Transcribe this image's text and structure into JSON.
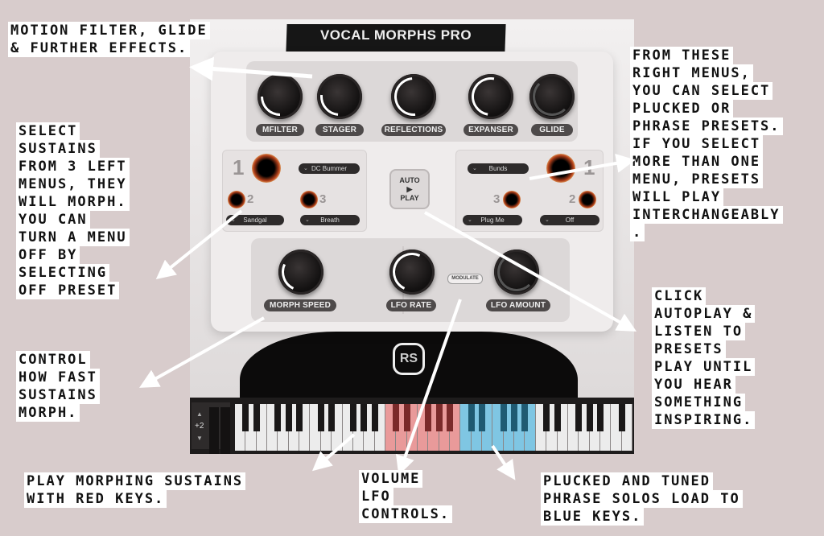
{
  "plugin": {
    "title": "VOCAL MORPHS PRO",
    "logo": "RS",
    "fx_knobs": [
      {
        "label": "MFILTER",
        "value": 0.15
      },
      {
        "label": "STAGER",
        "value": 0.2
      },
      {
        "label": "REFLECTIONS",
        "value": 0.45
      },
      {
        "label": "EXPANSER",
        "value": 0.55
      },
      {
        "label": "GLIDE",
        "value": 0.0
      }
    ],
    "left_menus": {
      "slot1": {
        "number": "1",
        "preset": "DC Bummer"
      },
      "slot2": {
        "number": "2",
        "preset": "Sandgal"
      },
      "slot3": {
        "number": "3",
        "preset": "Breath"
      }
    },
    "right_menus": {
      "slot1": {
        "number": "1",
        "preset": "Bunds"
      },
      "slot2": {
        "number": "2",
        "preset": "Off"
      },
      "slot3": {
        "number": "3",
        "preset": "Plug Me"
      }
    },
    "autoplay": {
      "line1": "AUTO",
      "icon": "▶",
      "line2": "PLAY"
    },
    "lower_knobs": [
      {
        "label": "MORPH SPEED",
        "value": 0.3
      },
      {
        "label": "LFO RATE",
        "value": 0.5
      },
      {
        "label": "LFO AMOUNT",
        "value": 0.0
      }
    ],
    "modulate_label": "MODULATE",
    "keyboard": {
      "octave": "+2",
      "red_range_color": "#e99a9a",
      "blue_range_color": "#7fc6e3"
    }
  },
  "annotations": {
    "top_left": [
      "MOTION FILTER, GLIDE",
      "& FURTHER EFFECTS."
    ],
    "left": [
      "SELECT",
      "SUSTAINS",
      "FROM 3 LEFT",
      "MENUS, THEY",
      "WILL MORPH.",
      "YOU CAN",
      "TURN A MENU",
      "OFF BY",
      "SELECTING",
      "OFF PRESET"
    ],
    "right": [
      "FROM THESE",
      "RIGHT MENUS,",
      "YOU CAN SELECT",
      "PLUCKED OR",
      "PHRASE PRESETS.",
      "IF YOU SELECT",
      "MORE THAN ONE",
      "MENU, PRESETS",
      "WILL PLAY",
      "INTERCHANGEABLY",
      "."
    ],
    "autoplay": [
      "CLICK",
      "AUTOPLAY &",
      "LISTEN TO",
      "PRESETS",
      "PLAY UNTIL",
      "YOU HEAR",
      "SOMETHING",
      "INSPIRING."
    ],
    "morph_speed": [
      "CONTROL",
      "HOW FAST",
      "SUSTAINS",
      "MORPH."
    ],
    "red_keys": [
      "PLAY MORPHING SUSTAINS",
      "WITH RED KEYS."
    ],
    "lfo": [
      "VOLUME",
      "LFO",
      "CONTROLS."
    ],
    "blue_keys": [
      "PLUCKED AND TUNED",
      "PHRASE SOLOS LOAD TO",
      "BLUE KEYS."
    ]
  },
  "colors": {
    "background": "#d8cccc",
    "annotation_bg": "#ffffff",
    "annotation_text": "#111111"
  }
}
